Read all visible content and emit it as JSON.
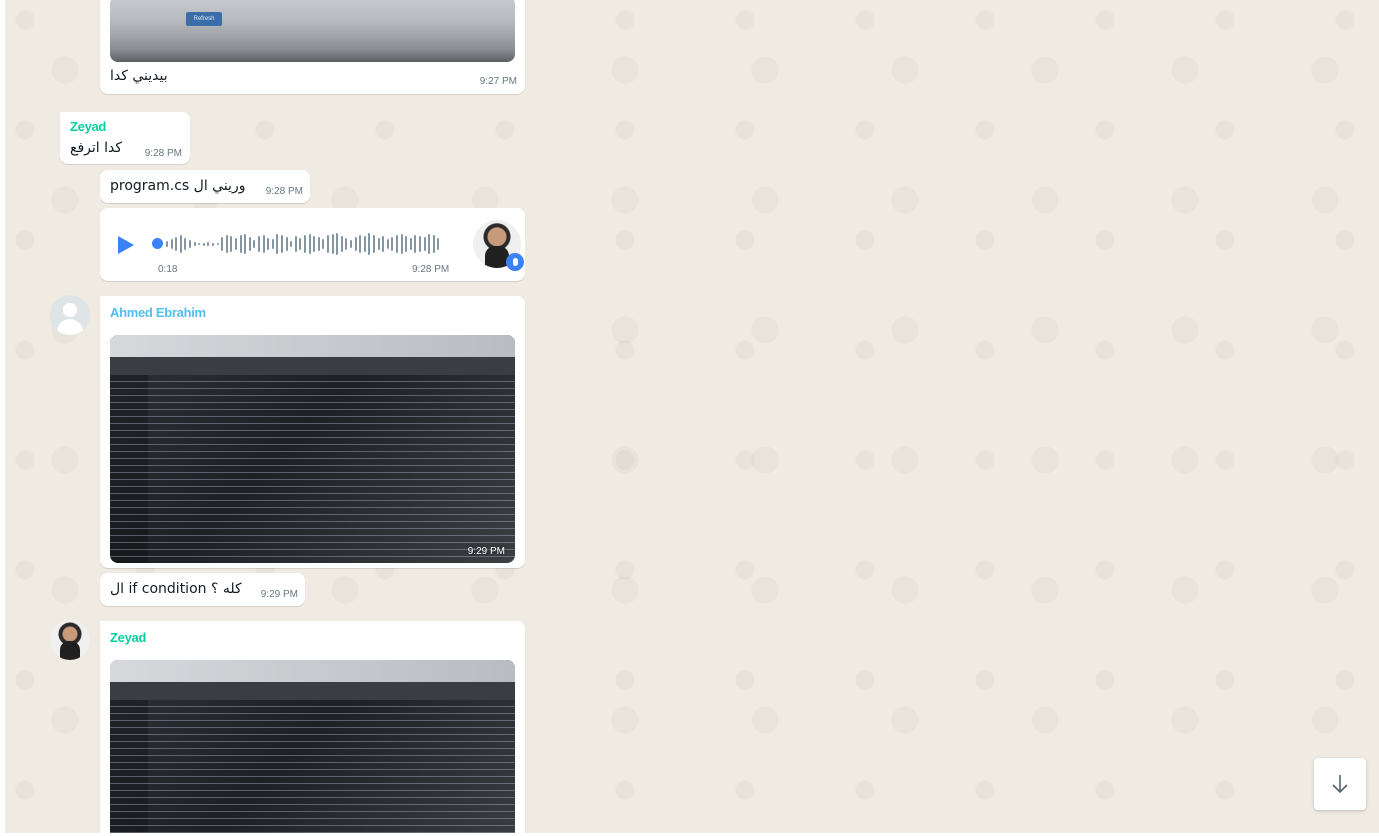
{
  "messages": {
    "m1": {
      "text": "بيديني كدا",
      "time": "9:27 PM",
      "image_button": "Refresh"
    },
    "m2": {
      "sender": "Zeyad",
      "text": "كدا اترفع",
      "time": "9:28 PM"
    },
    "m3": {
      "text": "وريني ال program.cs",
      "time": "9:28 PM"
    },
    "m4": {
      "duration": "0:18",
      "time": "9:28 PM",
      "type": "voice-note"
    },
    "m5": {
      "sender": "Ahmed Ebrahim",
      "time": "9:29 PM",
      "type": "image"
    },
    "m6": {
      "text": "كله ؟ if condition ال",
      "time": "9:29 PM"
    },
    "m7": {
      "sender": "Zeyad",
      "type": "image"
    }
  },
  "colors": {
    "chat_bg": "#efeae2",
    "bubble_bg": "#ffffff",
    "zeyad_name": "#06cf9c",
    "ahmed_name": "#53bdeb",
    "play": "#3b82f6",
    "mic_badge": "#3b82f6"
  },
  "icons": {
    "play": "play-icon",
    "mic": "mic-icon",
    "default_avatar": "default-avatar-icon",
    "scroll_down": "arrow-down-icon"
  }
}
